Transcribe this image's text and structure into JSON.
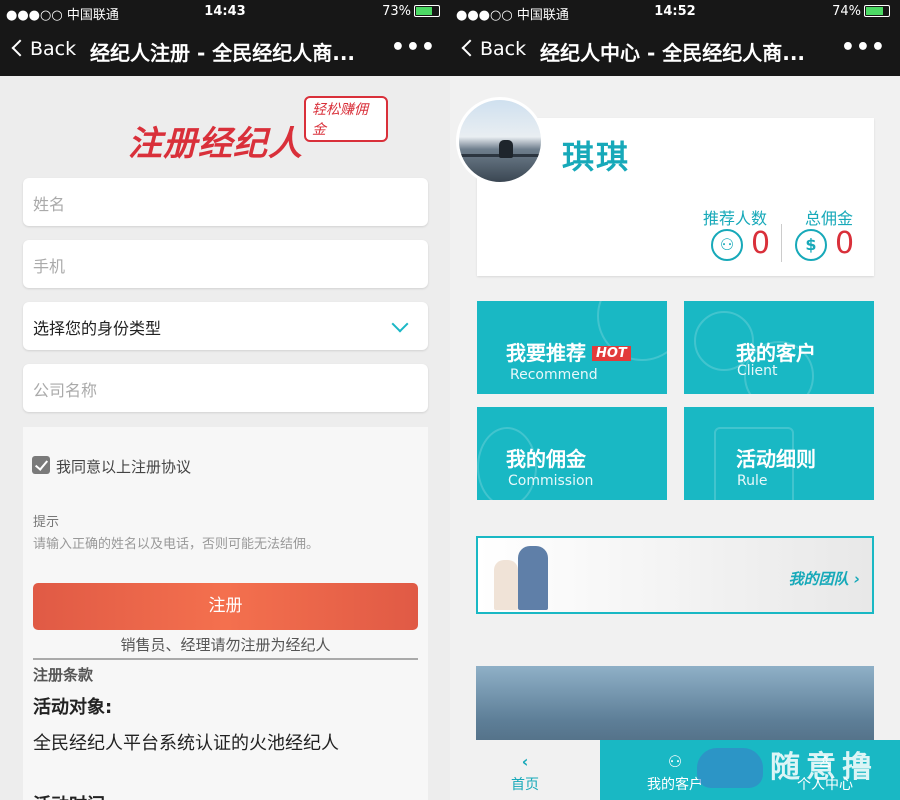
{
  "left": {
    "status": {
      "carrier": "●●●○○ 中国联通",
      "time": "14:43",
      "battery": "73%"
    },
    "nav": {
      "back": "Back",
      "title": "经纪人注册 - 全民经纪人商...",
      "more": "•••"
    },
    "logo": {
      "main": "注册经纪人",
      "tag": "轻松赚佣金"
    },
    "form": {
      "name_placeholder": "姓名",
      "phone_placeholder": "手机",
      "identity_select": "选择您的身份类型",
      "company_placeholder": "公司名称"
    },
    "agree_label": "我同意以上注册协议",
    "tip_title": "提示",
    "tip_text": "请输入正确的姓名以及电话，否则可能无法结佣。",
    "register_button": "注册",
    "note": "销售员、经理请勿注册为经纪人",
    "terms_heading": "注册条款",
    "activity_target_heading": "活动对象:",
    "activity_target_text": "全民经纪人平台系统认证的火池经纪人",
    "activity_time_heading": "活动时间:"
  },
  "right": {
    "status": {
      "carrier": "●●●○○ 中国联通",
      "time": "14:52",
      "battery": "74%"
    },
    "nav": {
      "back": "Back",
      "title": "经纪人中心 - 全民经纪人商...",
      "more": "•••"
    },
    "profile": {
      "name": "琪琪"
    },
    "stats": {
      "recommend_label": "推荐人数",
      "recommend_value": "0",
      "commission_label": "总佣金",
      "commission_value": "0"
    },
    "tiles": [
      {
        "cn": "我要推荐",
        "en": "Recommend",
        "badge": "HOT"
      },
      {
        "cn": "我的客户",
        "en": "Client"
      },
      {
        "cn": "我的佣金",
        "en": "Commission"
      },
      {
        "cn": "活动细则",
        "en": "Rule"
      }
    ],
    "team_label": "我的团队",
    "tabbar": [
      {
        "label": "首页",
        "icon": "chevron-left-icon"
      },
      {
        "label": "我的客户",
        "icon": "people-icon"
      },
      {
        "label": "个人中心",
        "icon": "person-icon"
      }
    ],
    "watermark": "随意撸"
  },
  "colors": {
    "accent": "#19b8c4",
    "brand_red": "#d9303a",
    "button": "#f06a4d",
    "nav_bg": "#171717"
  }
}
